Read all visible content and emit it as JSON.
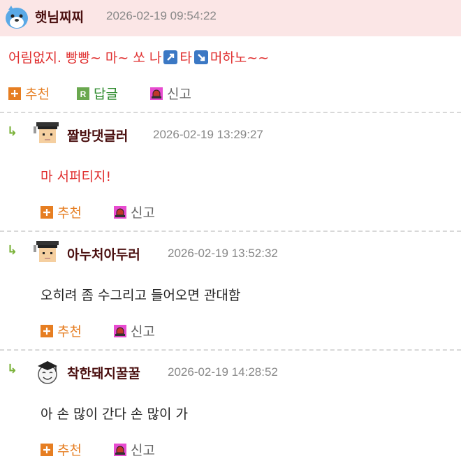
{
  "post": {
    "author": "햇님찌찌",
    "date": "2026-02-19 09:54:22",
    "text_parts": [
      "어림없지. 빵빵~ 마~ 쏘 나",
      "타",
      "머하노~~"
    ],
    "actions": {
      "recommend": "추천",
      "reply": "답글",
      "report": "신고"
    }
  },
  "comments": [
    {
      "author": "짤방댓글러",
      "date": "2026-02-19 13:29:27",
      "text": "마 서퍼티지!",
      "text_color": "#e03030",
      "recommend": "추천",
      "report": "신고"
    },
    {
      "author": "아누처아두러",
      "date": "2026-02-19 13:52:32",
      "text": "오히려 좀 수그리고 들어오면 관대함",
      "text_color": "#222222",
      "recommend": "추천",
      "report": "신고"
    },
    {
      "author": "착한돼지꿀꿀",
      "date": "2026-02-19 14:28:52",
      "text": "아 손 많이 간다 손 많이 가",
      "text_color": "#222222",
      "recommend": "추천",
      "report": "신고"
    }
  ],
  "colors": {
    "header_bg": "#fbe6e6",
    "accent_orange": "#e67e22",
    "accent_green": "#2e8b2e",
    "reply_arrow": "#7bb23a"
  },
  "icons": [
    "seal-avatar-icon",
    "arrow-up-right-icon",
    "arrow-down-right-icon",
    "plus-icon",
    "reply-r-icon",
    "siren-icon",
    "reply-arrow-icon",
    "pixel-grad-avatar-icon",
    "grad-cap-face-icon"
  ]
}
